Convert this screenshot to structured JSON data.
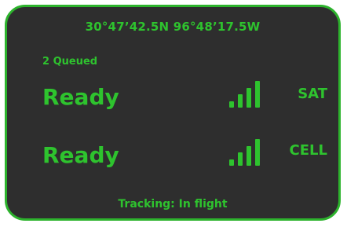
{
  "header": {
    "coordinates": "30°47’42.5N 96°48’17.5W"
  },
  "queue": {
    "label": "2 Queued"
  },
  "links": [
    {
      "status": "Ready",
      "signal_bars": 4,
      "network": "SAT",
      "icon": "signal-strength-icon"
    },
    {
      "status": "Ready",
      "signal_bars": 4,
      "network": "CELL",
      "icon": "signal-strength-icon"
    }
  ],
  "footer": {
    "tracking": "Tracking: In flight"
  },
  "colors": {
    "panel_bg": "#2e2e2e",
    "accent_green": "#2ec32e",
    "border_green": "#2db32d"
  }
}
